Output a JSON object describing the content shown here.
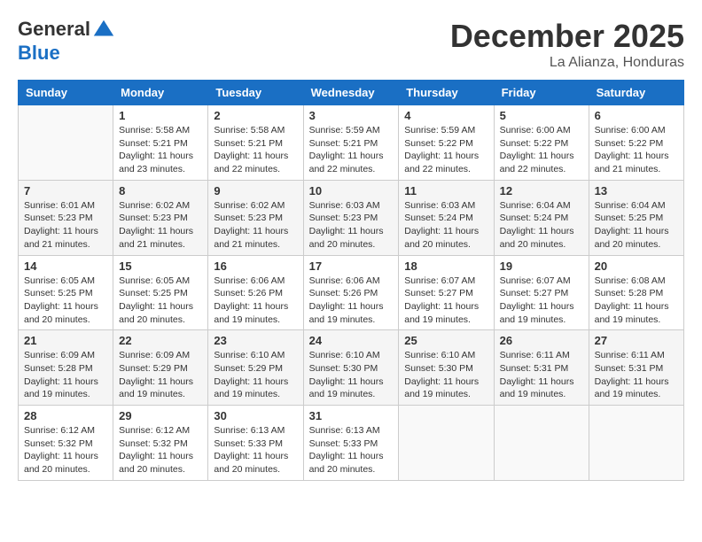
{
  "header": {
    "logo_line1": "General",
    "logo_line2": "Blue",
    "month": "December 2025",
    "location": "La Alianza, Honduras"
  },
  "weekdays": [
    "Sunday",
    "Monday",
    "Tuesday",
    "Wednesday",
    "Thursday",
    "Friday",
    "Saturday"
  ],
  "weeks": [
    [
      {
        "day": "",
        "info": ""
      },
      {
        "day": "1",
        "info": "Sunrise: 5:58 AM\nSunset: 5:21 PM\nDaylight: 11 hours\nand 23 minutes."
      },
      {
        "day": "2",
        "info": "Sunrise: 5:58 AM\nSunset: 5:21 PM\nDaylight: 11 hours\nand 22 minutes."
      },
      {
        "day": "3",
        "info": "Sunrise: 5:59 AM\nSunset: 5:21 PM\nDaylight: 11 hours\nand 22 minutes."
      },
      {
        "day": "4",
        "info": "Sunrise: 5:59 AM\nSunset: 5:22 PM\nDaylight: 11 hours\nand 22 minutes."
      },
      {
        "day": "5",
        "info": "Sunrise: 6:00 AM\nSunset: 5:22 PM\nDaylight: 11 hours\nand 22 minutes."
      },
      {
        "day": "6",
        "info": "Sunrise: 6:00 AM\nSunset: 5:22 PM\nDaylight: 11 hours\nand 21 minutes."
      }
    ],
    [
      {
        "day": "7",
        "info": "Sunrise: 6:01 AM\nSunset: 5:23 PM\nDaylight: 11 hours\nand 21 minutes."
      },
      {
        "day": "8",
        "info": "Sunrise: 6:02 AM\nSunset: 5:23 PM\nDaylight: 11 hours\nand 21 minutes."
      },
      {
        "day": "9",
        "info": "Sunrise: 6:02 AM\nSunset: 5:23 PM\nDaylight: 11 hours\nand 21 minutes."
      },
      {
        "day": "10",
        "info": "Sunrise: 6:03 AM\nSunset: 5:23 PM\nDaylight: 11 hours\nand 20 minutes."
      },
      {
        "day": "11",
        "info": "Sunrise: 6:03 AM\nSunset: 5:24 PM\nDaylight: 11 hours\nand 20 minutes."
      },
      {
        "day": "12",
        "info": "Sunrise: 6:04 AM\nSunset: 5:24 PM\nDaylight: 11 hours\nand 20 minutes."
      },
      {
        "day": "13",
        "info": "Sunrise: 6:04 AM\nSunset: 5:25 PM\nDaylight: 11 hours\nand 20 minutes."
      }
    ],
    [
      {
        "day": "14",
        "info": "Sunrise: 6:05 AM\nSunset: 5:25 PM\nDaylight: 11 hours\nand 20 minutes."
      },
      {
        "day": "15",
        "info": "Sunrise: 6:05 AM\nSunset: 5:25 PM\nDaylight: 11 hours\nand 20 minutes."
      },
      {
        "day": "16",
        "info": "Sunrise: 6:06 AM\nSunset: 5:26 PM\nDaylight: 11 hours\nand 19 minutes."
      },
      {
        "day": "17",
        "info": "Sunrise: 6:06 AM\nSunset: 5:26 PM\nDaylight: 11 hours\nand 19 minutes."
      },
      {
        "day": "18",
        "info": "Sunrise: 6:07 AM\nSunset: 5:27 PM\nDaylight: 11 hours\nand 19 minutes."
      },
      {
        "day": "19",
        "info": "Sunrise: 6:07 AM\nSunset: 5:27 PM\nDaylight: 11 hours\nand 19 minutes."
      },
      {
        "day": "20",
        "info": "Sunrise: 6:08 AM\nSunset: 5:28 PM\nDaylight: 11 hours\nand 19 minutes."
      }
    ],
    [
      {
        "day": "21",
        "info": "Sunrise: 6:09 AM\nSunset: 5:28 PM\nDaylight: 11 hours\nand 19 minutes."
      },
      {
        "day": "22",
        "info": "Sunrise: 6:09 AM\nSunset: 5:29 PM\nDaylight: 11 hours\nand 19 minutes."
      },
      {
        "day": "23",
        "info": "Sunrise: 6:10 AM\nSunset: 5:29 PM\nDaylight: 11 hours\nand 19 minutes."
      },
      {
        "day": "24",
        "info": "Sunrise: 6:10 AM\nSunset: 5:30 PM\nDaylight: 11 hours\nand 19 minutes."
      },
      {
        "day": "25",
        "info": "Sunrise: 6:10 AM\nSunset: 5:30 PM\nDaylight: 11 hours\nand 19 minutes."
      },
      {
        "day": "26",
        "info": "Sunrise: 6:11 AM\nSunset: 5:31 PM\nDaylight: 11 hours\nand 19 minutes."
      },
      {
        "day": "27",
        "info": "Sunrise: 6:11 AM\nSunset: 5:31 PM\nDaylight: 11 hours\nand 19 minutes."
      }
    ],
    [
      {
        "day": "28",
        "info": "Sunrise: 6:12 AM\nSunset: 5:32 PM\nDaylight: 11 hours\nand 20 minutes."
      },
      {
        "day": "29",
        "info": "Sunrise: 6:12 AM\nSunset: 5:32 PM\nDaylight: 11 hours\nand 20 minutes."
      },
      {
        "day": "30",
        "info": "Sunrise: 6:13 AM\nSunset: 5:33 PM\nDaylight: 11 hours\nand 20 minutes."
      },
      {
        "day": "31",
        "info": "Sunrise: 6:13 AM\nSunset: 5:33 PM\nDaylight: 11 hours\nand 20 minutes."
      },
      {
        "day": "",
        "info": ""
      },
      {
        "day": "",
        "info": ""
      },
      {
        "day": "",
        "info": ""
      }
    ]
  ]
}
